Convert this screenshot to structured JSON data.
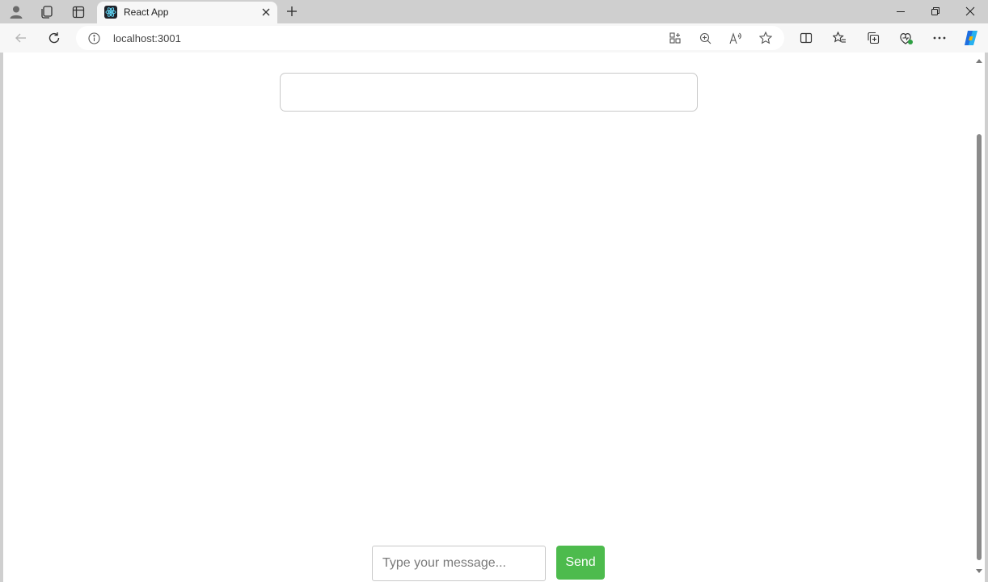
{
  "browser": {
    "tab": {
      "title": "React App"
    },
    "address_bar": {
      "url": "localhost:3001"
    }
  },
  "page": {
    "message_input": {
      "value": "",
      "placeholder": "Type your message..."
    },
    "send_button": {
      "label": "Send"
    },
    "colors": {
      "send_button_bg": "#4dbb4d",
      "tab_strip_bg": "#cfcfcf",
      "page_bg": "#ffffff"
    }
  },
  "icons": {
    "tabstrip": [
      "profile-icon",
      "workspaces-icon",
      "tab-actions-icon"
    ],
    "tab": [
      "react-favicon-icon",
      "close-icon"
    ],
    "window": [
      "minimize-icon",
      "restore-icon",
      "close-window-icon"
    ],
    "toolbar": [
      "back-icon",
      "refresh-icon",
      "info-icon",
      "app-available-icon",
      "zoom-icon",
      "read-aloud-icon",
      "favorite-star-icon",
      "split-screen-icon",
      "favorites-icon",
      "collections-icon",
      "browser-essentials-icon",
      "more-icon",
      "copilot-icon"
    ]
  }
}
